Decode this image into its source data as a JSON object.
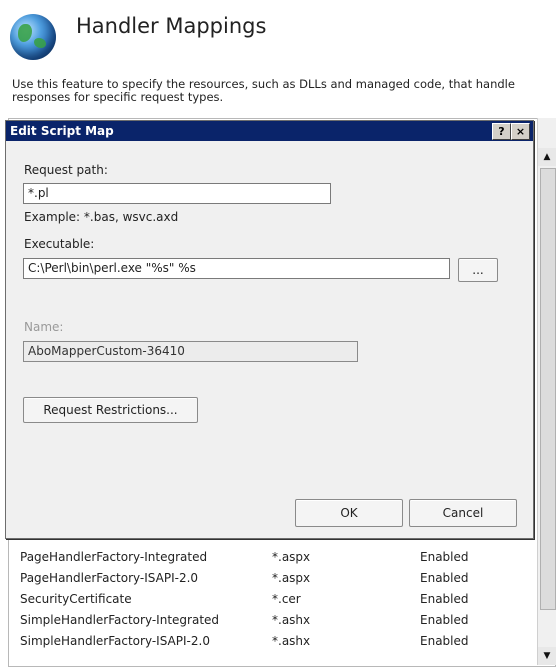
{
  "page": {
    "title": "Handler Mappings",
    "description": "Use this feature to specify the resources, such as DLLs and managed code, that handle responses for specific request types."
  },
  "dialog": {
    "title": "Edit Script Map",
    "help_glyph": "?",
    "close_glyph": "×",
    "request_path_label": "Request path:",
    "request_path_value": "*.pl",
    "request_path_example": "Example: *.bas, wsvc.axd",
    "executable_label": "Executable:",
    "executable_value": "C:\\Perl\\bin\\perl.exe \"%s\" %s",
    "browse_label": "...",
    "name_label": "Name:",
    "name_value": "AboMapperCustom-36410",
    "restrictions_label": "Request Restrictions...",
    "ok_label": "OK",
    "cancel_label": "Cancel"
  },
  "list": {
    "rows": [
      {
        "name": "PageHandlerFactory-Integrated",
        "path": "*.aspx",
        "state": "Enabled"
      },
      {
        "name": "PageHandlerFactory-ISAPI-2.0",
        "path": "*.aspx",
        "state": "Enabled"
      },
      {
        "name": "SecurityCertificate",
        "path": "*.cer",
        "state": "Enabled"
      },
      {
        "name": "SimpleHandlerFactory-Integrated",
        "path": "*.ashx",
        "state": "Enabled"
      },
      {
        "name": "SimpleHandlerFactory-ISAPI-2.0",
        "path": "*.ashx",
        "state": "Enabled"
      }
    ]
  },
  "icons": {
    "page_icon": "globe-icon",
    "scroll_up": "▲",
    "scroll_down": "▼"
  },
  "colors": {
    "titlebar": "#0a246a"
  }
}
